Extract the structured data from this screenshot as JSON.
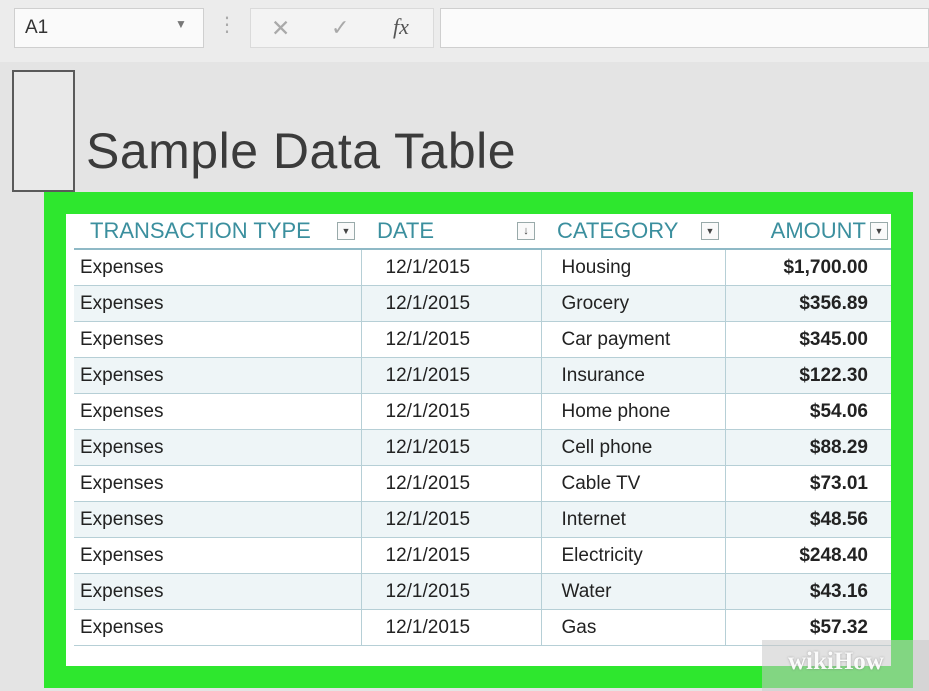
{
  "formula_bar": {
    "name_box": "A1",
    "name_box_arrow": "▼",
    "separator": "⋮",
    "cancel_symbol": "✕",
    "enter_symbol": "✓",
    "function_symbol": "fx",
    "formula_value": ""
  },
  "sheet": {
    "title": "Sample Data Table"
  },
  "table": {
    "headers": {
      "transaction_type": "TRANSACTION TYPE",
      "date": "DATE",
      "category": "CATEGORY",
      "amount": "AMOUNT"
    },
    "filter_icons": {
      "dropdown": "▼",
      "sorted": "↓"
    },
    "rows": [
      {
        "type": "Expenses",
        "date": "12/1/2015",
        "category": "Housing",
        "amount": "$1,700.00"
      },
      {
        "type": "Expenses",
        "date": "12/1/2015",
        "category": "Grocery",
        "amount": "$356.89"
      },
      {
        "type": "Expenses",
        "date": "12/1/2015",
        "category": "Car payment",
        "amount": "$345.00"
      },
      {
        "type": "Expenses",
        "date": "12/1/2015",
        "category": "Insurance",
        "amount": "$122.30"
      },
      {
        "type": "Expenses",
        "date": "12/1/2015",
        "category": "Home phone",
        "amount": "$54.06"
      },
      {
        "type": "Expenses",
        "date": "12/1/2015",
        "category": "Cell phone",
        "amount": "$88.29"
      },
      {
        "type": "Expenses",
        "date": "12/1/2015",
        "category": "Cable TV",
        "amount": "$73.01"
      },
      {
        "type": "Expenses",
        "date": "12/1/2015",
        "category": "Internet",
        "amount": "$48.56"
      },
      {
        "type": "Expenses",
        "date": "12/1/2015",
        "category": "Electricity",
        "amount": "$248.40"
      },
      {
        "type": "Expenses",
        "date": "12/1/2015",
        "category": "Water",
        "amount": "$43.16"
      },
      {
        "type": "Expenses",
        "date": "12/1/2015",
        "category": "Gas",
        "amount": "$57.32"
      }
    ]
  },
  "watermark": {
    "wiki": "wiki",
    "how": "How"
  },
  "colors": {
    "highlight_frame": "#2ee72e",
    "header_text": "#3b8f9e",
    "band_row": "#eef5f7"
  }
}
